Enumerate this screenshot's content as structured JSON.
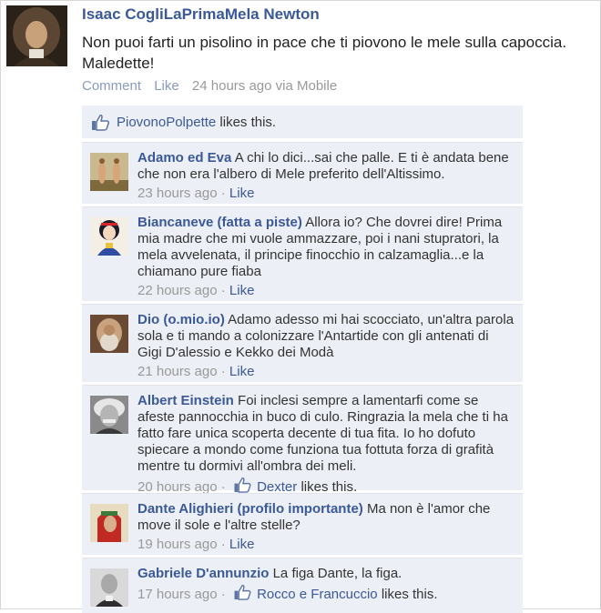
{
  "post": {
    "author": "Isaac CogliLaPrimaMela Newton",
    "text": "Non puoi farti un pisolino in pace che ti piovono le mele sulla capoccia. Maledette!",
    "actions": {
      "comment": "Comment",
      "like": "Like",
      "time": "24 hours ago via Mobile"
    }
  },
  "likes": {
    "who": "PiovonoPolpette",
    "suffix": " likes this."
  },
  "comments": [
    {
      "author": "Adamo ed Eva",
      "text": "A chi lo dici...sai che palle. E ti è andata bene che non era l'albero di Mele preferito dell'Altissimo.",
      "time": "23 hours ago",
      "like": "Like"
    },
    {
      "author": "Biancaneve (fatta a piste)",
      "text": "Allora io? Che dovrei dire! Prima mia madre che mi vuole ammazzare, poi i nani stupratori, la mela avvelenata, il principe finocchio in calzamaglia...e la chiamano pure fiaba",
      "time": "22 hours ago",
      "like": "Like"
    },
    {
      "author": "Dio (o.mio.io)",
      "text": "Adamo adesso mi hai scocciato, un'altra parola sola e ti mando a colonizzare l'Antartide con gli antenati di Gigi D'alessio e Kekko dei Modà",
      "time": "21 hours ago",
      "like": "Like"
    },
    {
      "author": "Albert Einstein",
      "text": "Foi inclesi sempre a lamentarfi come se afeste pannocchia in buco di culo. Ringrazia la mela che ti ha fatto fare unica scoperta decente di tua fita. Io ho dofuto spiecare a mondo come funziona tua fottuta forza di grafità mentre tu dormivi all'ombra dei meli.",
      "time": "20 hours ago",
      "liker": "Dexter",
      "liker_suffix": " likes this."
    },
    {
      "author": "Dante Alighieri (profilo importante)",
      "text": "Ma non è l'amor che move il sole e l'altre stelle?",
      "time": "19 hours ago",
      "like": "Like"
    },
    {
      "author": "Gabriele D'annunzio",
      "text": "La figa Dante, la figa.",
      "time": "17 hours ago",
      "liker": "Rocco e Francuccio",
      "liker_suffix": " likes this."
    }
  ],
  "separator": "·"
}
